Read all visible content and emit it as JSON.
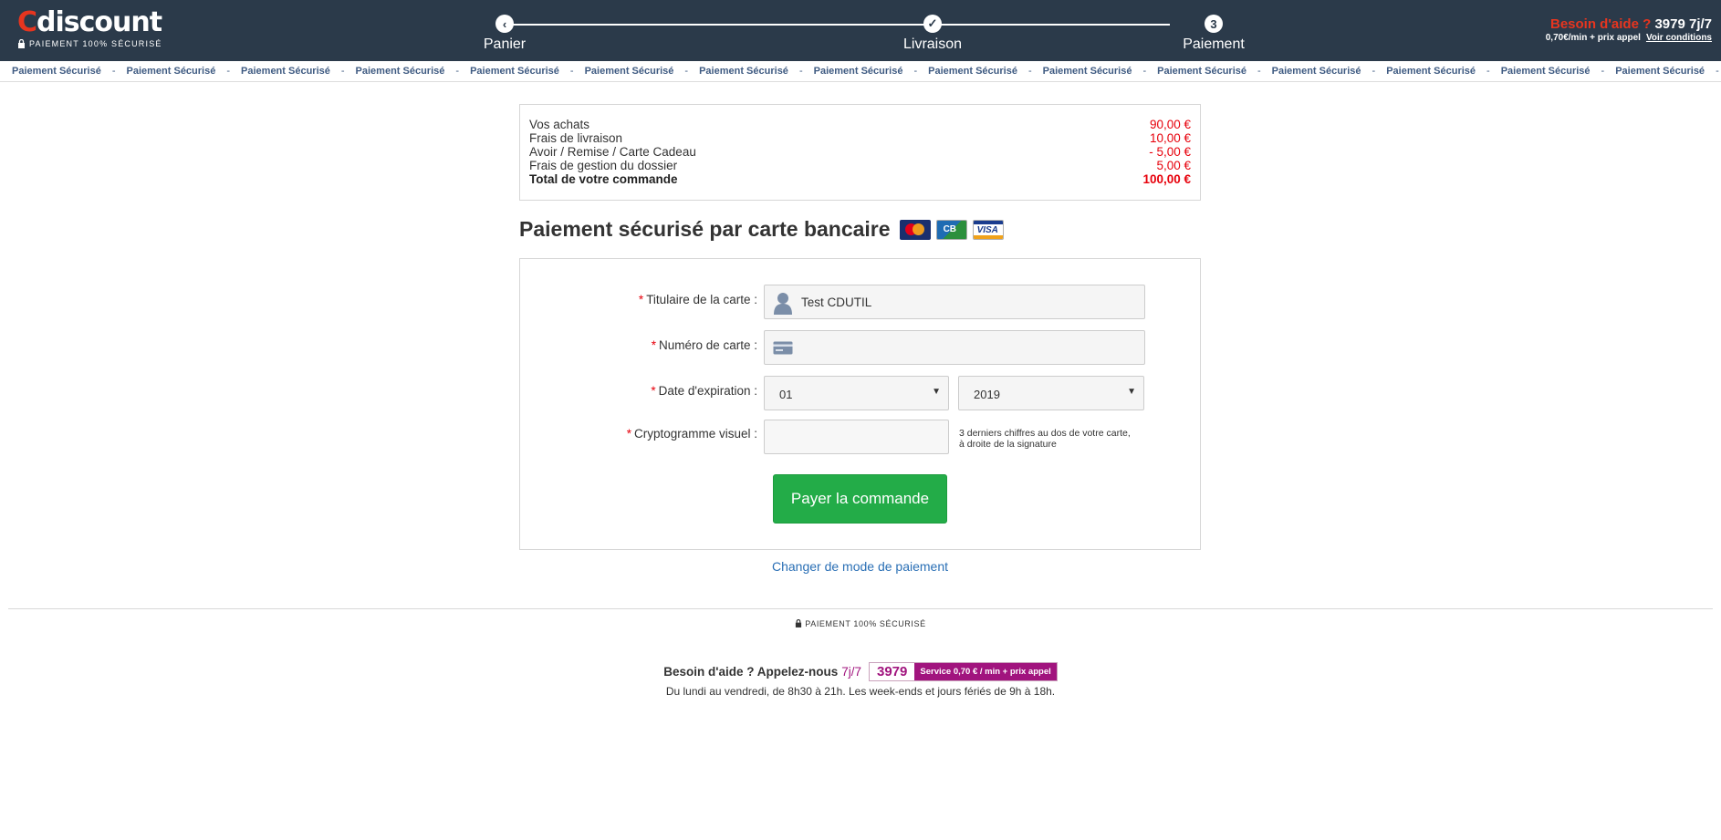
{
  "header": {
    "logo_text": "discount",
    "logo_c": "C",
    "logo_sub": "PAIEMENT 100% SÉCURISÉ",
    "steps": [
      {
        "label": "Panier",
        "icon": "chevron-left-icon",
        "glyph": "‹"
      },
      {
        "label": "Livraison",
        "icon": "check-icon",
        "glyph": "✓"
      },
      {
        "label": "Paiement",
        "icon": "step-number",
        "glyph": "3"
      }
    ],
    "help": {
      "question": "Besoin d'aide ?",
      "number": "3979 7j/7",
      "price": "0,70€/min + prix appel",
      "conditions_link": "Voir conditions"
    }
  },
  "band": {
    "item": "Paiement Sécurisé",
    "separator": "-"
  },
  "summary": {
    "rows": [
      {
        "label": "Vos achats",
        "value": "90,00 €"
      },
      {
        "label": "Frais de livraison",
        "value": "10,00 €"
      },
      {
        "label": "Avoir / Remise / Carte Cadeau",
        "value": "- 5,00 €"
      },
      {
        "label": "Frais de gestion du dossier",
        "value": "5,00 €"
      }
    ],
    "total_label": "Total de votre commande",
    "total_value": "100,00 €"
  },
  "payment": {
    "title": "Paiement sécurisé par carte bancaire",
    "card_logos": [
      "mastercard-icon",
      "cb-icon",
      "visa-icon"
    ],
    "required_mark": "*",
    "holder_label": "Titulaire de la carte :",
    "holder_value": "Test CDUTIL",
    "number_label": "Numéro de carte :",
    "number_value": "",
    "expiry_label": "Date d'expiration :",
    "expiry_month": "01",
    "expiry_year": "2019",
    "cvv_label": "Cryptogramme visuel :",
    "cvv_value": "",
    "cvv_hint_line1": "3 derniers chiffres au dos de votre carte,",
    "cvv_hint_line2": "à droite de la signature",
    "pay_button": "Payer la commande",
    "change_mode_link": "Changer de mode de paiement"
  },
  "footer": {
    "secure_text": "PAIEMENT 100% SÉCURISÉ",
    "help_text": "Besoin d'aide ? Appelez-nous",
    "help_days": "7j/7",
    "number": "3979",
    "service_text": "Service  0,70 € / min  + prix appel",
    "hours": "Du lundi au vendredi, de 8h30 à 21h. Les week-ends et jours fériés de 9h à 18h."
  },
  "colors": {
    "header_bg": "#2b3a4a",
    "accent_red": "#e7351f",
    "price_red": "#e7000b",
    "button_green": "#23ac48",
    "link_blue": "#2a6fb5",
    "magenta": "#a1147e"
  }
}
